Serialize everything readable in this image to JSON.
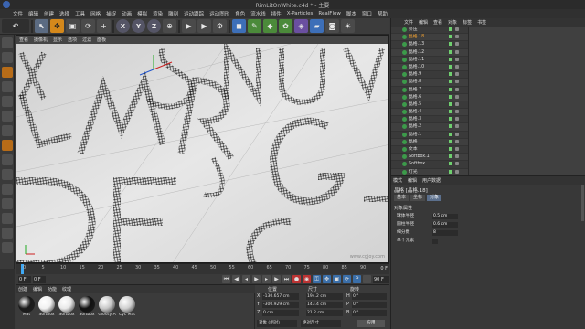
{
  "window": {
    "title": "RimLitOnWhite.c4d * - 主要"
  },
  "menu": [
    "文件",
    "编辑",
    "创建",
    "选择",
    "工具",
    "网格",
    "捕捉",
    "动画",
    "模拟",
    "渲染",
    "雕刻",
    "运动跟踪",
    "运动图形",
    "角色",
    "流水线",
    "插件",
    "X-Particles",
    "RealFlow",
    "脚本",
    "窗口",
    "帮助"
  ],
  "viewport": {
    "menu": [
      "查看",
      "摄像机",
      "显示",
      "选项",
      "过滤",
      "面板"
    ],
    "watermark": "www.cgjoy.com"
  },
  "timeline": {
    "ticks": [
      "0",
      "5",
      "10",
      "15",
      "20",
      "25",
      "30",
      "35",
      "40",
      "45",
      "50",
      "55",
      "60",
      "65",
      "70",
      "75",
      "80",
      "85",
      "90"
    ],
    "frame_indicator": "0 F",
    "start_field": "0 F",
    "end_field": "0 F",
    "end_frame": "90 F"
  },
  "materials": {
    "menu": [
      "创建",
      "编辑",
      "功能",
      "纹理"
    ],
    "items": [
      {
        "label": "Mat",
        "color": "#1a1a1a"
      },
      {
        "label": "Softbox",
        "color": "#f0f0f0"
      },
      {
        "label": "Softbox",
        "color": "#e8e8e8"
      },
      {
        "label": "Softbox",
        "color": "#101010"
      },
      {
        "label": "Glossy A",
        "color": "#c8c8c8"
      },
      {
        "label": "Cyc Mat",
        "color": "#d0d0d0"
      }
    ]
  },
  "coords": {
    "headers": {
      "position": "位置",
      "size": "尺寸",
      "rotation": "旋转"
    },
    "rows": [
      {
        "axis": "X",
        "pos": "-130.657 cm",
        "size": "194.2 cm",
        "rot_axis": "H",
        "rot": "0 °"
      },
      {
        "axis": "Y",
        "pos": "-300.929 cm",
        "size": "143.4 cm",
        "rot_axis": "P",
        "rot": "0 °"
      },
      {
        "axis": "Z",
        "pos": "0 cm",
        "size": "21.2 cm",
        "rot_axis": "B",
        "rot": "0 °"
      }
    ],
    "dropdown_object": "对象 (相对)",
    "dropdown_size": "绝对尺寸",
    "apply": "应用"
  },
  "objects": {
    "menu": [
      "文件",
      "编辑",
      "查看",
      "对象",
      "标签",
      "书签"
    ],
    "items": [
      {
        "name": "挤压",
        "selected": false
      },
      {
        "name": "晶格.18",
        "selected": true
      },
      {
        "name": "晶格.13",
        "selected": false
      },
      {
        "name": "晶格.12",
        "selected": false
      },
      {
        "name": "晶格.11",
        "selected": false
      },
      {
        "name": "晶格.10",
        "selected": false
      },
      {
        "name": "晶格.9",
        "selected": false
      },
      {
        "name": "晶格.8",
        "selected": false
      },
      {
        "name": "晶格.7",
        "selected": false
      },
      {
        "name": "晶格.6",
        "selected": false
      },
      {
        "name": "晶格.5",
        "selected": false
      },
      {
        "name": "晶格.4",
        "selected": false
      },
      {
        "name": "晶格.3",
        "selected": false
      },
      {
        "name": "晶格.2",
        "selected": false
      },
      {
        "name": "晶格.1",
        "selected": false
      },
      {
        "name": "晶格",
        "selected": false
      },
      {
        "name": "文本",
        "selected": false
      },
      {
        "name": "Softbox.1",
        "selected": false
      },
      {
        "name": "Softbox",
        "selected": false
      },
      {
        "name": "灯光",
        "selected": false
      }
    ]
  },
  "attributes": {
    "menu": [
      "模式",
      "编辑",
      "用户数据"
    ],
    "title": "晶格 [晶格.18]",
    "tabs": [
      {
        "label": "基本",
        "active": false
      },
      {
        "label": "坐标",
        "active": false
      },
      {
        "label": "对象",
        "active": true
      }
    ],
    "section": "对象属性",
    "fields": [
      {
        "label": "球体半径",
        "value": "0.5 cm"
      },
      {
        "label": "圆柱半径",
        "value": "0.6 cm"
      },
      {
        "label": "细分数",
        "value": "8"
      },
      {
        "label": "单个元素",
        "value": ""
      }
    ]
  },
  "colors": {
    "accent_blue": "#3fa9f5",
    "selected_text": "#f0a030",
    "object_green": "#3c9a4a"
  }
}
